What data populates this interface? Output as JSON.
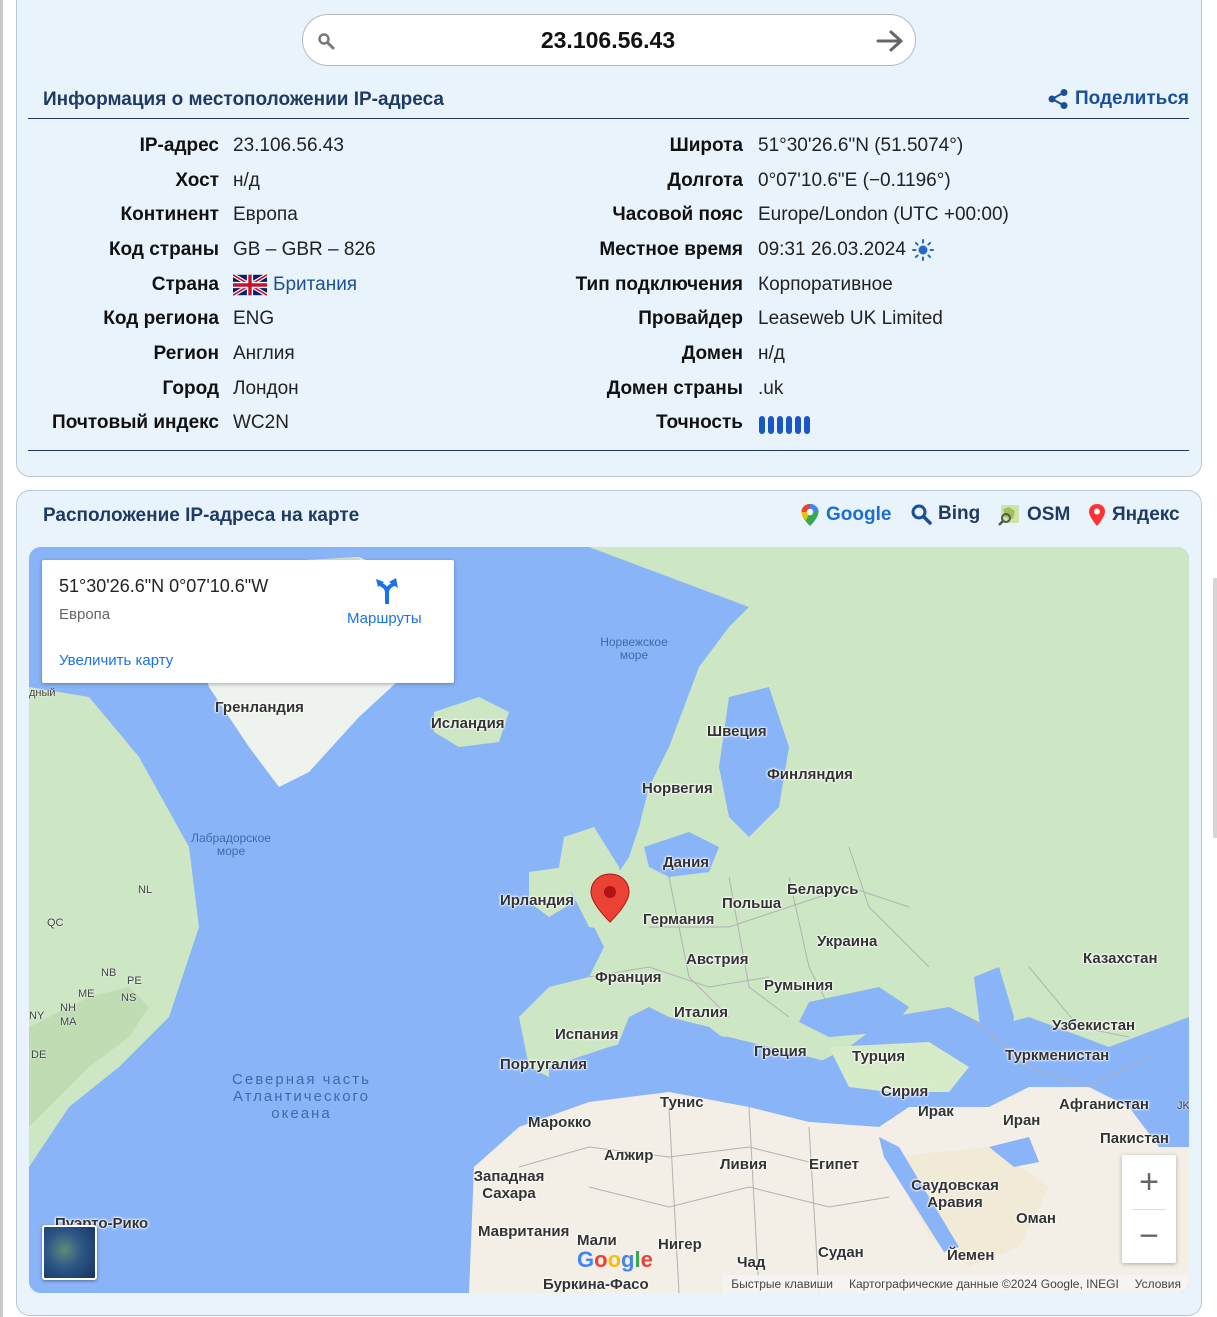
{
  "search": {
    "value": "23.106.56.43"
  },
  "info": {
    "title": "Информация о местоположении IP-адреса",
    "share_label": "Поделиться",
    "left": [
      {
        "label": "IP-адрес",
        "value": "23.106.56.43"
      },
      {
        "label": "Хост",
        "value": "н/д"
      },
      {
        "label": "Континент",
        "value": "Европа"
      },
      {
        "label": "Код страны",
        "value": "GB – GBR – 826"
      },
      {
        "label": "Страна",
        "value": "Британия"
      },
      {
        "label": "Код региона",
        "value": "ENG"
      },
      {
        "label": "Регион",
        "value": "Англия"
      },
      {
        "label": "Город",
        "value": "Лондон"
      },
      {
        "label": "Почтовый индекс",
        "value": "WC2N"
      }
    ],
    "right": [
      {
        "label": "Широта",
        "value": "51°30'26.6\"N (51.5074°)"
      },
      {
        "label": "Долгота",
        "value": "0°07'10.6\"E (−0.1196°)"
      },
      {
        "label": "Часовой пояс",
        "value": "Europe/London (UTC +00:00)"
      },
      {
        "label": "Местное время",
        "value": "09:31 26.03.2024"
      },
      {
        "label": "Тип подключения",
        "value": "Корпоративное"
      },
      {
        "label": "Провайдер",
        "value": "Leaseweb UK Limited"
      },
      {
        "label": "Домен",
        "value": "н/д"
      },
      {
        "label": "Домен страны",
        "value": ".uk"
      },
      {
        "label": "Точность",
        "value": ""
      }
    ],
    "accuracy_level": 6,
    "accuracy_max": 6
  },
  "map_section": {
    "title": "Расположение IP-адреса на карте",
    "providers": [
      "Google",
      "Bing",
      "OSM",
      "Яндекс"
    ]
  },
  "map": {
    "infobox": {
      "coords": "51°30'26.6\"N 0°07'10.6\"W",
      "region": "Европа",
      "enlarge": "Увеличить карту",
      "route": "Маршруты"
    },
    "labels": {
      "greenland": "Гренландия",
      "iceland": "Исландия",
      "sweden": "Швеция",
      "finland": "Финляндия",
      "norway": "Норвегия",
      "denmark": "Дания",
      "ireland": "Ирландия",
      "belarus": "Беларусь",
      "poland": "Польша",
      "germany": "Германия",
      "ukraine": "Украина",
      "austria": "Австрия",
      "france": "Франция",
      "kazakhstan": "Казахстан",
      "romania": "Румыния",
      "italy": "Италия",
      "spain": "Испания",
      "uzbekistan": "Узбекистан",
      "greece": "Греция",
      "turkey": "Турция",
      "turkmenistan": "Туркменистан",
      "portugal": "Португалия",
      "tunisia": "Тунис",
      "syria": "Сирия",
      "afghanistan": "Афганистан",
      "iraq": "Ирак",
      "iran": "Иран",
      "morocco": "Марокко",
      "pakistan": "Пакистан",
      "algeria": "Алжир",
      "libya": "Ливия",
      "egypt": "Египет",
      "west_sahara": "Западная Сахара",
      "saudi": "Саудовская Аравия",
      "oman": "Оман",
      "mauritania": "Мавритания",
      "mali": "Мали",
      "niger": "Нигер",
      "chad": "Чад",
      "sudan": "Судан",
      "yemen": "Йемен",
      "puerto_rico": "Пуэрто-Рико",
      "burkina": "Буркина-Фасо"
    },
    "seas": {
      "norwegian": "Норвежское море",
      "labrador": "Лабрадорское море",
      "atlantic": "Северная часть Атлантического океана"
    },
    "codes": [
      "NL",
      "QC",
      "NB",
      "PE",
      "ME",
      "NS",
      "NH",
      "NY",
      "MA",
      "DE"
    ],
    "edge_text": "дный",
    "edge_text_right": "JK",
    "attribution": {
      "shortcuts": "Быстрые клавиши",
      "data": "Картографические данные ©2024 Google, INEGI",
      "terms": "Условия"
    },
    "google_logo": "Google"
  },
  "colors": {
    "card_bg": "#e9f3fc",
    "title": "#1f3a63",
    "link": "#1b4f98",
    "water": "#8ab4f8",
    "land": "#cde6c4",
    "desert": "#f3efe6",
    "pin": "#ea4335"
  }
}
